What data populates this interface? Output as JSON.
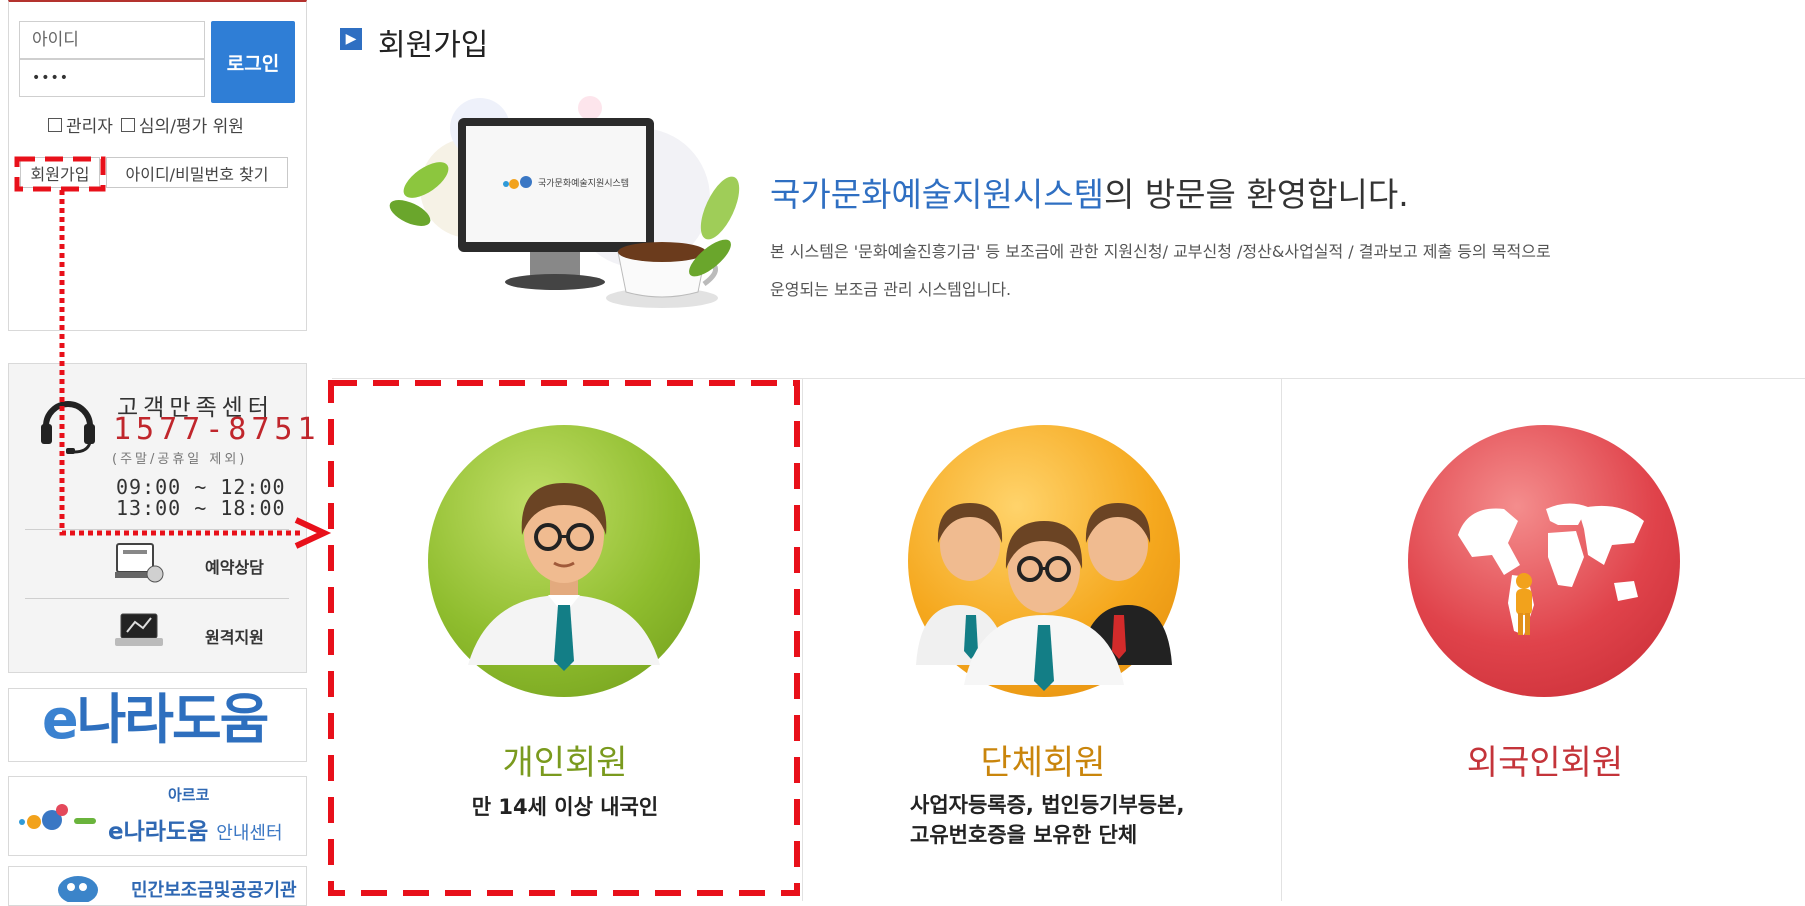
{
  "login": {
    "id_placeholder": "아이디",
    "password_value": "••••",
    "login_button": "로그인",
    "role_admin": "관리자",
    "role_reviewer": "심의/평가 위원",
    "signup_button": "회원가입",
    "find_account_button": "아이디/비밀번호 찾기"
  },
  "customer_center": {
    "title": "고객만족센터",
    "phone": "1577-8751",
    "note": "(주말/공휴일 제외)",
    "hours_am": "09:00 ~ 12:00",
    "hours_pm": "13:00 ~ 18:00",
    "reservation_label": "예약상담",
    "remote_label": "원격지원"
  },
  "banners": {
    "enara_e": "e",
    "enara_rest": "나라도움",
    "arko_top": "아르코",
    "arko_main": "e나라도움",
    "arko_sub": "안내센터",
    "minbo": "민간보조금및공공기관"
  },
  "section": {
    "title": "회원가입",
    "welcome_highlight": "국가문화예술지원시스템",
    "welcome_rest": "의 방문을 환영합니다.",
    "desc_line1": "본 시스템은 '문화예술진흥기금' 등 보조금에 관한 지원신청/ 교부신청 /정산&사업실적 / 결과보고 제출 등의 목적으로",
    "desc_line2": "운영되는 보조금 관리 시스템입니다.",
    "monitor_logo_text": "국가문화예술지원시스템"
  },
  "members": [
    {
      "title": "개인회원",
      "desc1": "만 14세 이상 내국인",
      "desc2": "",
      "color": "#7a9a1e"
    },
    {
      "title": "단체회원",
      "desc1": "사업자등록증, 법인등기부등본,",
      "desc2": "고유번호증을 보유한 단체",
      "color": "#c9850c"
    },
    {
      "title": "외국인회원",
      "desc1": "",
      "desc2": "",
      "color": "#c4343a"
    }
  ],
  "colors": {
    "accent": "#2f6fc2",
    "highlight_dashed": "#e8101a",
    "phone": "#c0262c"
  }
}
